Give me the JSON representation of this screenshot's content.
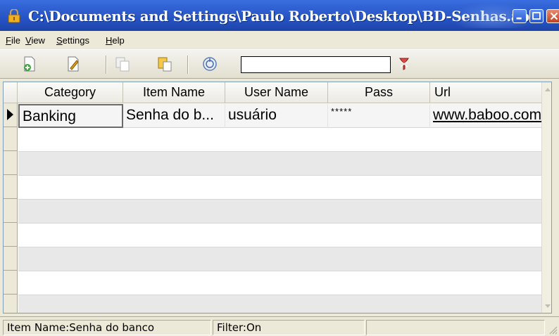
{
  "window": {
    "title": "C:\\Documents and Settings\\Paulo Roberto\\Desktop\\BD-Senhas.abs",
    "icon": "lock-icon",
    "accent_color": "#2450bf"
  },
  "menu": {
    "items": [
      {
        "label": "File",
        "access": "F",
        "rest": "ile"
      },
      {
        "label": "View",
        "access": "V",
        "rest": "iew"
      },
      {
        "label": "Settings",
        "access": "S",
        "rest": "ettings"
      },
      {
        "label": "Help",
        "access": "H",
        "rest": "elp"
      }
    ]
  },
  "toolbar": {
    "buttons": [
      "new-entry-icon",
      "edit-entry-icon",
      "copy-icon",
      "paste-icon",
      "browse-url-icon"
    ],
    "filter_value": "",
    "clear_filter_icon": "clear-filter-icon"
  },
  "grid": {
    "columns": [
      "Category",
      "Item Name",
      "User Name",
      "Pass",
      "Url"
    ],
    "rows": [
      {
        "category": "Banking",
        "item_name": "Senha do b...",
        "user_name": "usuário",
        "pass": "*****",
        "url": "www.baboo.com"
      }
    ],
    "empty_rows": 8
  },
  "status": {
    "item": "Item Name:Senha do banco",
    "filter": "Filter:On",
    "extra": ""
  }
}
